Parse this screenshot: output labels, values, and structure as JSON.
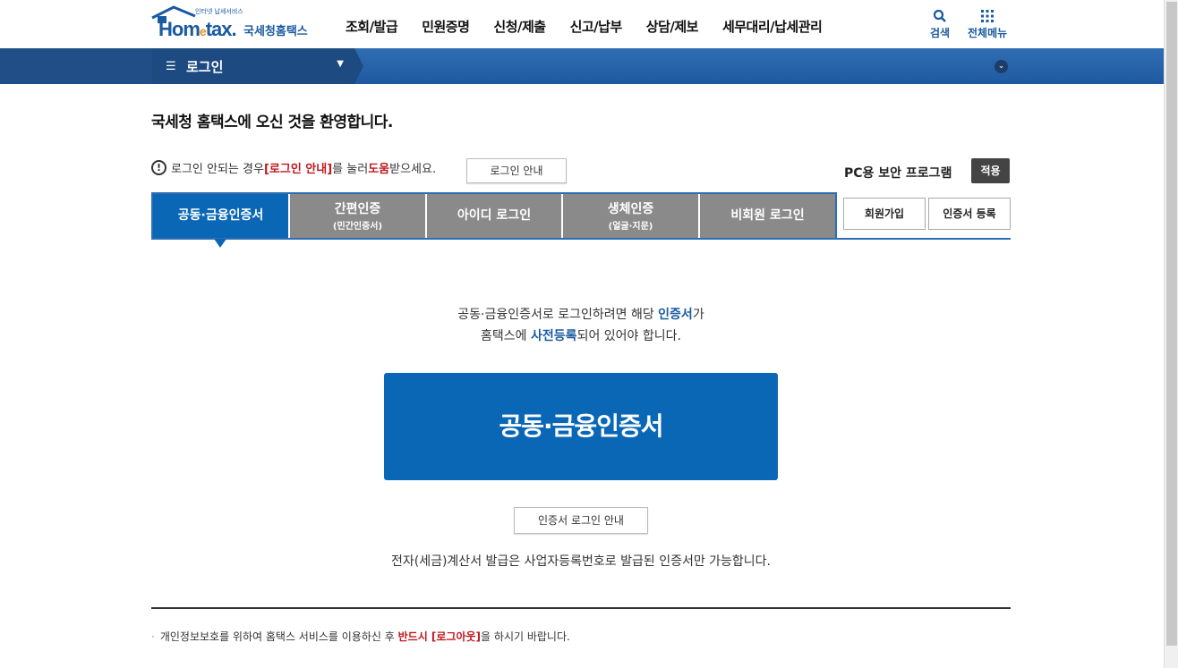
{
  "header": {
    "logo_small": "인터넷 납세서비스",
    "logo_brand_a": "Hom",
    "logo_brand_e": "e",
    "logo_brand_b": "tax.",
    "logo_korean": "국세청홈택스",
    "nav": [
      "조회/발급",
      "민원증명",
      "신청/제출",
      "신고/납부",
      "상담/제보",
      "세무대리/납세관리"
    ],
    "search_label": "검색",
    "allmenu_label": "전체메뉴"
  },
  "navbar": {
    "menu_label": "로그인"
  },
  "content": {
    "welcome": "국세청 홈택스에 오신 것을 환영합니다.",
    "notice_prefix": "로그인 안되는 경우 ",
    "notice_red": "[로그인 안내]",
    "notice_mid": "를 눌러 ",
    "notice_red2": "도움",
    "notice_suffix": "받으세요.",
    "login_guide_btn": "로그인 안내",
    "pc_security_label": "PC용 보안 프로그램",
    "apply_btn": "적용"
  },
  "tabs": [
    {
      "label": "공동·금융인증서",
      "sub": "",
      "active": true
    },
    {
      "label": "간편인증",
      "sub": "(민간인증서)",
      "active": false
    },
    {
      "label": "아이디 로그인",
      "sub": "",
      "active": false
    },
    {
      "label": "생체인증",
      "sub": "(얼굴·지문)",
      "active": false
    },
    {
      "label": "비회원 로그인",
      "sub": "",
      "active": false
    }
  ],
  "side_buttons": {
    "signup": "회원가입",
    "cert_register": "인증서 등록"
  },
  "panel": {
    "line1_a": "공동·금융인증서로 로그인하려면 해당 ",
    "line1_blue": "인증서",
    "line1_b": "가",
    "line2_a": "홈택스에 ",
    "line2_blue": "사전등록",
    "line2_b": "되어 있어야 합니다.",
    "big_button": "공동·금융인증서",
    "cert_guide_btn": "인증서 로그인 안내",
    "bottom_note": "전자(세금)계산서 발급은 사업자등록번호로 발급된 인증서만 가능합니다."
  },
  "footer": {
    "prefix": "개인정보보호를 위하여 홈택스 서비스를 이용하신 후 ",
    "red": "반드시 [로그아웃]",
    "suffix": "을 하시기 바랍니다."
  },
  "colors": {
    "primary": "#0a67b5",
    "navbar": "#2f6db2",
    "tab_inactive": "#8a8a8a",
    "alert_red": "#c0181e"
  }
}
